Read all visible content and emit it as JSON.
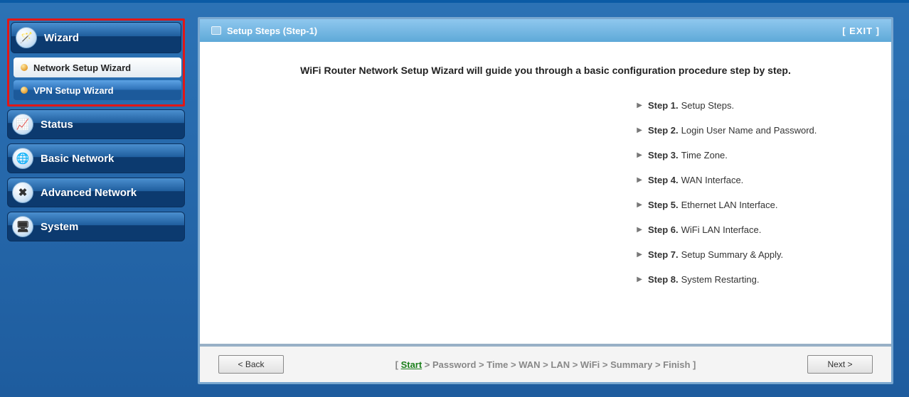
{
  "sidebar": {
    "wizard_label": "Wizard",
    "subitems": [
      {
        "label": "Network Setup Wizard"
      },
      {
        "label": "VPN Setup Wizard"
      }
    ],
    "items": [
      {
        "label": "Status",
        "icon": "📈"
      },
      {
        "label": "Basic Network",
        "icon": "🌐"
      },
      {
        "label": "Advanced Network",
        "icon": "✖"
      },
      {
        "label": "System",
        "icon": "🖥"
      }
    ]
  },
  "panel": {
    "title": "Setup Steps (Step-1)",
    "exit": "[ EXIT ]"
  },
  "intro": "WiFi Router Network Setup Wizard will guide you through a basic configuration procedure step by step.",
  "steps": [
    {
      "label": "Step 1.",
      "text": "Setup Steps."
    },
    {
      "label": "Step 2.",
      "text": "Login User Name and Password."
    },
    {
      "label": "Step 3.",
      "text": "Time Zone."
    },
    {
      "label": "Step 4.",
      "text": "WAN Interface."
    },
    {
      "label": "Step 5.",
      "text": "Ethernet LAN Interface."
    },
    {
      "label": "Step 6.",
      "text": "WiFi LAN Interface."
    },
    {
      "label": "Step 7.",
      "text": "Setup Summary & Apply."
    },
    {
      "label": "Step 8.",
      "text": "System Restarting."
    }
  ],
  "footer": {
    "back": "< Back",
    "next": "Next >",
    "bc_open": "[ ",
    "bc_close": " ]",
    "bc_sep": " > ",
    "bc_current": "Start",
    "bc_rest": [
      "Password",
      "Time",
      "WAN",
      "LAN",
      "WiFi",
      "Summary",
      "Finish"
    ]
  }
}
